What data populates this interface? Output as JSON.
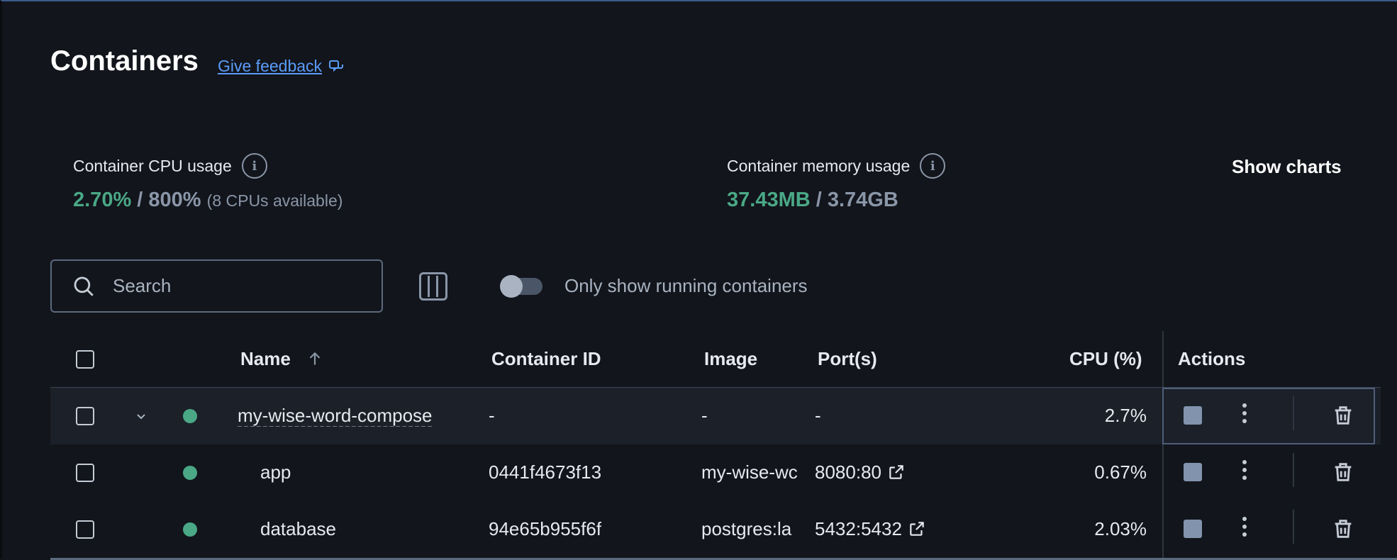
{
  "header": {
    "title": "Containers",
    "feedback_label": "Give feedback"
  },
  "stats": {
    "cpu": {
      "label": "Container CPU usage",
      "used": "2.70%",
      "separator": "/",
      "total": "800%",
      "note": "(8 CPUs available)"
    },
    "memory": {
      "label": "Container memory usage",
      "used": "37.43MB",
      "separator": "/",
      "total": "3.74GB"
    },
    "show_charts_label": "Show charts"
  },
  "toolbar": {
    "search_placeholder": "Search",
    "toggle_label": "Only show running containers",
    "toggle_on": false
  },
  "table": {
    "columns": {
      "name": "Name",
      "container_id": "Container ID",
      "image": "Image",
      "ports": "Port(s)",
      "cpu": "CPU (%)",
      "actions": "Actions"
    },
    "group": {
      "name": "my-wise-word-compose",
      "container_id": "-",
      "image": "-",
      "ports": "-",
      "cpu": "2.7%"
    },
    "rows": [
      {
        "name": "app",
        "container_id": "0441f4673f13",
        "image": "my-wise-wc",
        "ports": "8080:80",
        "cpu": "0.67%"
      },
      {
        "name": "database",
        "container_id": "94e65b955f6f",
        "image": "postgres:la",
        "ports": "5432:5432",
        "cpu": "2.03%"
      }
    ]
  },
  "colors": {
    "accent": "#5a9cf8",
    "running": "#4aa886",
    "background": "#12151b"
  }
}
